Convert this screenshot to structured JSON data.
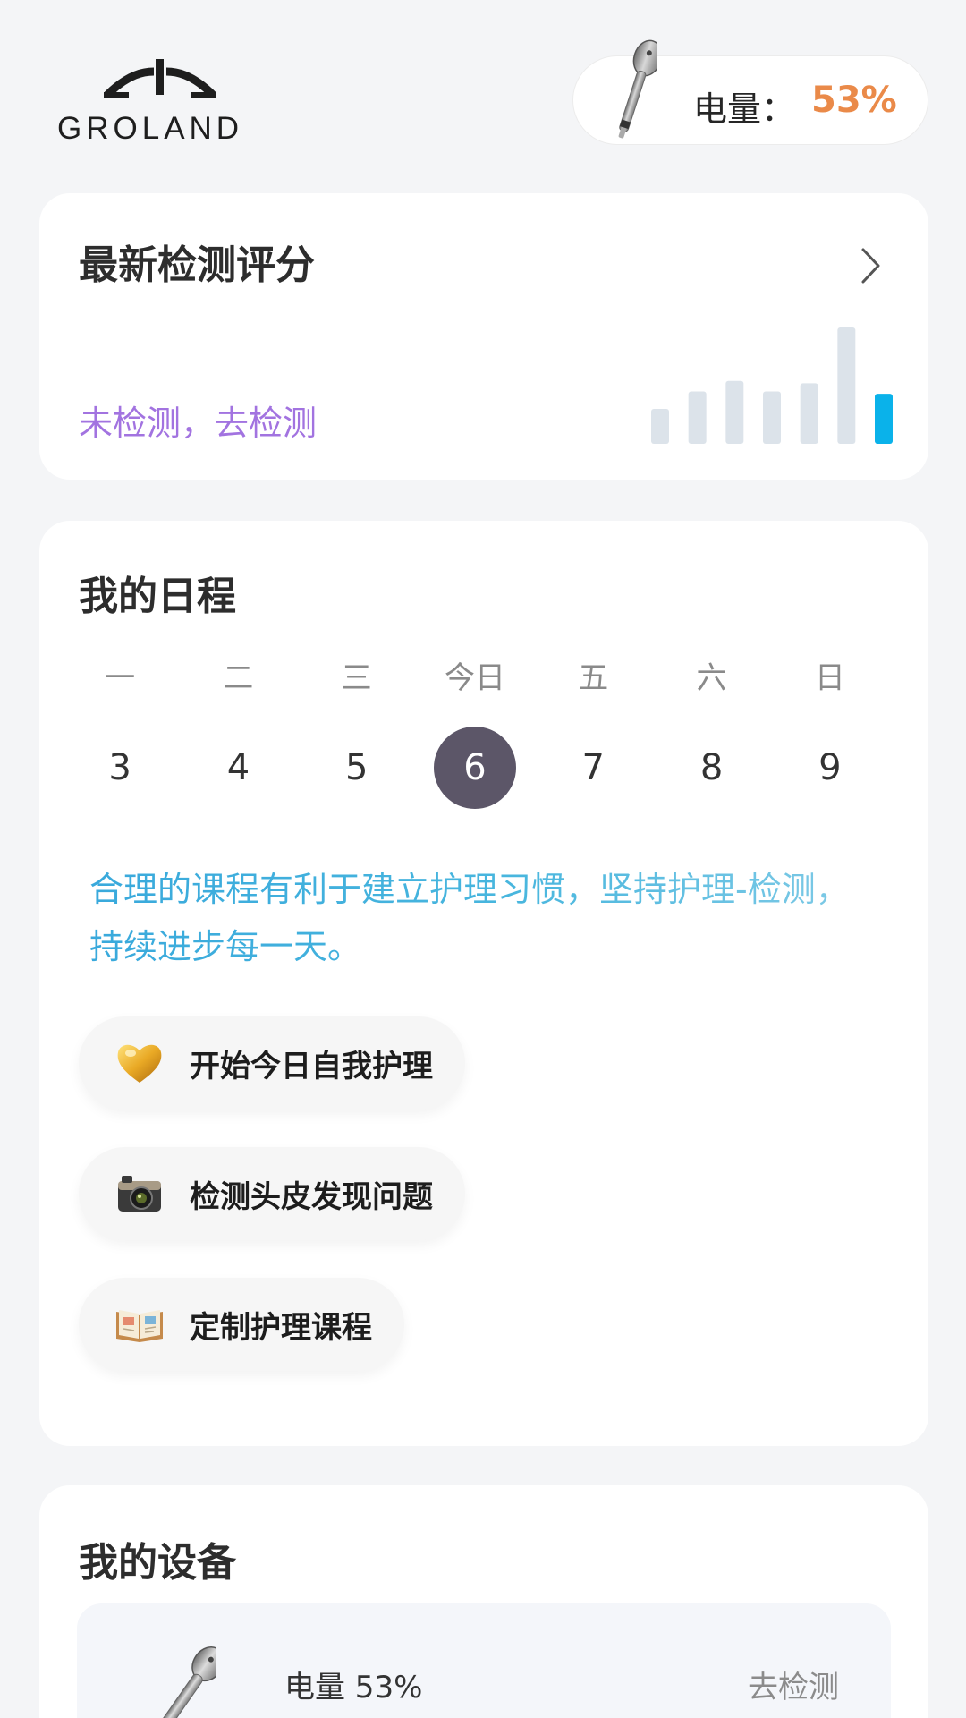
{
  "header": {
    "brand": "GROLAND",
    "battery_label": "电量：",
    "battery_value": "53%"
  },
  "score_card": {
    "title": "最新检测评分",
    "cta": "未检测，去检测",
    "arrow_icon": "chevron-right-icon",
    "history_bars": [
      0.3,
      0.45,
      0.54,
      0.45,
      0.52,
      1.0,
      0.43
    ],
    "bar_color": "#dce3ea",
    "active_bar_color": "#0ab2ea"
  },
  "schedule": {
    "title": "我的日程",
    "weekdays": [
      "一",
      "二",
      "三",
      "今日",
      "五",
      "六",
      "日"
    ],
    "dates": [
      "3",
      "4",
      "5",
      "6",
      "7",
      "8",
      "9"
    ],
    "today_index": 3,
    "tip": "合理的课程有利于建立护理习惯，坚持护理-检测，持续进步每一天。",
    "actions": [
      {
        "label": "开始今日自我护理",
        "icon": "golden-heart-icon"
      },
      {
        "label": "检测头皮发现问题",
        "icon": "camera-icon"
      },
      {
        "label": "定制护理课程",
        "icon": "open-book-icon"
      }
    ]
  },
  "devices": {
    "title": "我的设备",
    "battery_text": "电量 53%",
    "action": "去检测"
  }
}
